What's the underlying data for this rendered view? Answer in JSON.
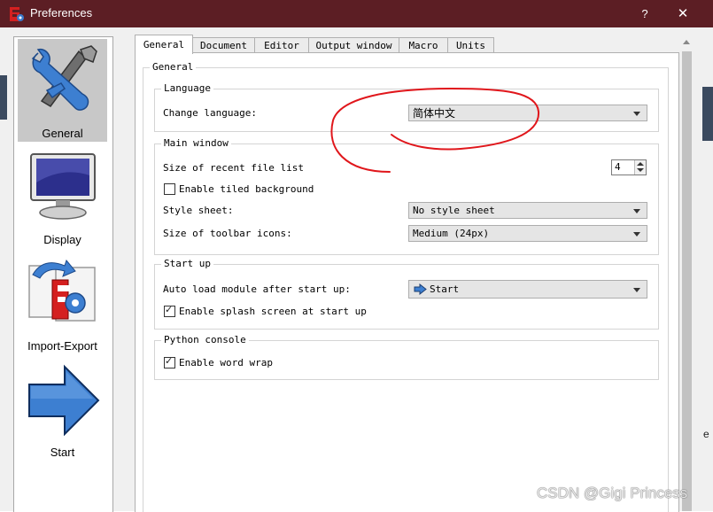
{
  "window": {
    "title": "Preferences",
    "help_label": "?",
    "close_label": "✕"
  },
  "sidebar": {
    "items": [
      {
        "label": "General",
        "icon": "wrench-screwdriver-icon",
        "selected": true
      },
      {
        "label": "Display",
        "icon": "monitor-icon",
        "selected": false
      },
      {
        "label": "Import-Export",
        "icon": "import-export-icon",
        "selected": false
      },
      {
        "label": "Start",
        "icon": "arrow-right-icon",
        "selected": false
      }
    ]
  },
  "tabs": [
    "General",
    "Document",
    "Editor",
    "Output window",
    "Macro",
    "Units"
  ],
  "active_tab": "General",
  "general": {
    "title": "General",
    "language": {
      "title": "Language",
      "change_language_label": "Change language:",
      "change_language_value": "简体中文"
    },
    "main_window": {
      "title": "Main window",
      "recent_files_label": "Size of recent file list",
      "recent_files_value": "4",
      "tiled_background_label": "Enable tiled background",
      "tiled_background_checked": false,
      "style_sheet_label": "Style sheet:",
      "style_sheet_value": "No style sheet",
      "toolbar_icons_label": "Size of toolbar icons:",
      "toolbar_icons_value": "Medium (24px)"
    },
    "start_up": {
      "title": "Start up",
      "auto_load_label": "Auto load module after start up:",
      "auto_load_value": "Start",
      "splash_label": "Enable splash screen at start up",
      "splash_checked": true
    },
    "python_console": {
      "title": "Python console",
      "word_wrap_label": "Enable word wrap",
      "word_wrap_checked": true
    }
  },
  "background": {
    "right_edge_letter": "e"
  },
  "watermark": "CSDN @Gigi Princess",
  "colors": {
    "titlebar": "#5c1e24",
    "annotation_red": "#e0161b",
    "selected_item": "#c8c8c8"
  }
}
